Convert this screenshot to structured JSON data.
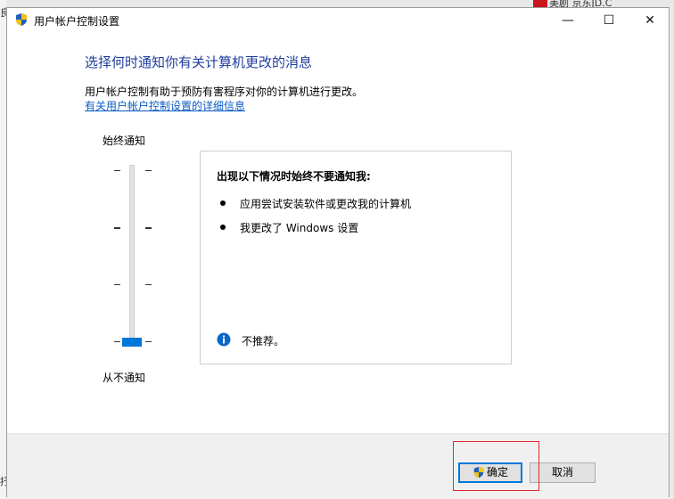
{
  "background": {
    "taskbar_right": "美剧 京东JD.C",
    "left_chars": [
      "良",
      "抒"
    ]
  },
  "window": {
    "title": "用户帐户控制设置",
    "controls": {
      "minimize": "—",
      "maximize": "☐",
      "close": "✕"
    }
  },
  "main": {
    "heading": "选择何时通知你有关计算机更改的消息",
    "description": "用户帐户控制有助于预防有害程序对你的计算机进行更改。",
    "link": "有关用户帐户控制设置的详细信息"
  },
  "slider": {
    "top_label": "始终通知",
    "bottom_label": "从不通知",
    "levels": 4,
    "selected_level": 1
  },
  "info_panel": {
    "title": "出现以下情况时始终不要通知我:",
    "items": [
      "应用尝试安装软件或更改我的计算机",
      "我更改了 Windows 设置"
    ],
    "note": "不推荐。"
  },
  "buttons": {
    "ok": "确定",
    "cancel": "取消"
  },
  "colors": {
    "accent": "#0078d7",
    "heading": "#1e3d9c",
    "link": "#0a5bc4",
    "highlight": "#e0292f"
  }
}
